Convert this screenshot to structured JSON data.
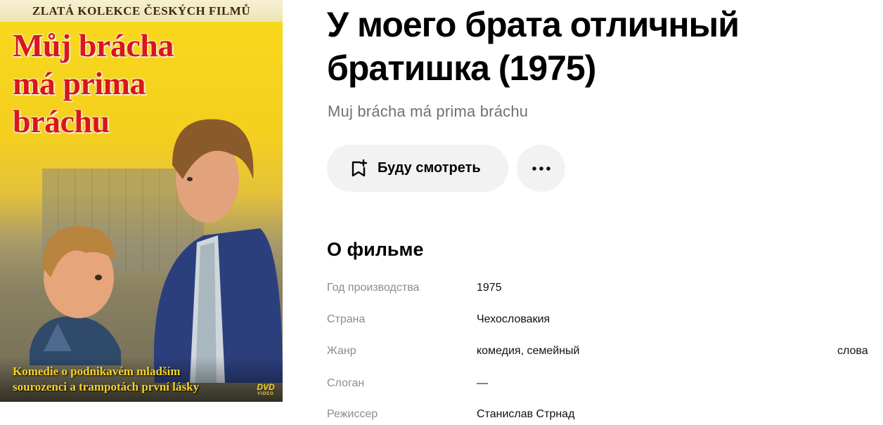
{
  "poster": {
    "collection_label": "ZLATÁ KOLEKCE ČESKÝCH FILMŮ",
    "title_lines": [
      "Můj brácha",
      "má prima",
      "bráchu"
    ],
    "tagline_lines": [
      "Komedie o podnikavém mladším",
      "sourozenci a trampotách první lásky"
    ],
    "dvd_label": "DVD",
    "dvd_sub": "VIDEO",
    "colors": {
      "background": "#f6d21f",
      "title": "#d8161c",
      "tagline": "#f5d326"
    }
  },
  "film": {
    "title": "У моего брата отличный братишка (1975)",
    "original_title": "Muj brácha má prima bráchu"
  },
  "actions": {
    "watch_later_label": "Буду смотреть",
    "watch_later_icon": "bookmark-plus-icon",
    "more_icon": "more-dots-icon"
  },
  "about": {
    "heading": "О фильме",
    "rows": [
      {
        "key": "Год производства",
        "value": "1975"
      },
      {
        "key": "Страна",
        "value": "Чехословакия"
      },
      {
        "key": "Жанр",
        "value": "комедия, семейный",
        "extra": "слова"
      },
      {
        "key": "Слоган",
        "value": "—"
      },
      {
        "key": "Режиссер",
        "value": "Станислав Стрнад"
      }
    ]
  },
  "colors": {
    "button_bg": "#f2f2f2",
    "muted_text": "#8c8c8c",
    "subtitle_text": "#717171"
  }
}
